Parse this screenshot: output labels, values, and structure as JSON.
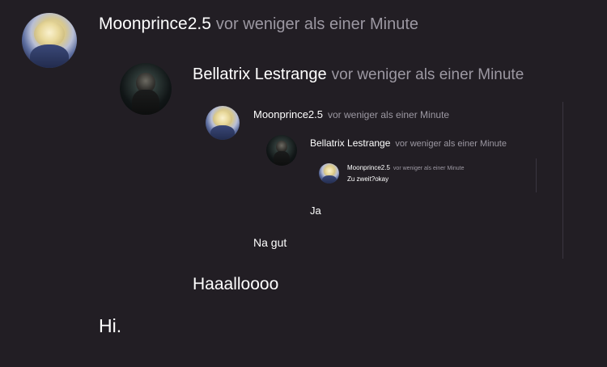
{
  "comments": {
    "level1": {
      "username": "Moonprince2.5",
      "timestamp": "vor weniger als einer Minute",
      "message": "Hi."
    },
    "level2": {
      "username": "Bellatrix Lestrange",
      "timestamp": "vor weniger als einer Minute",
      "message": "Haaalloooo"
    },
    "level3": {
      "username": "Moonprince2.5",
      "timestamp": "vor weniger als einer Minute",
      "message": "Na gut"
    },
    "level4": {
      "username": "Bellatrix Lestrange",
      "timestamp": "vor weniger als einer Minute",
      "message": "Ja"
    },
    "level5": {
      "username": "Moonprince2.5",
      "timestamp": "vor weniger als einer Minute",
      "message": "Zu zweit?okay"
    }
  },
  "colors": {
    "background": "#221e24",
    "text": "#ffffff",
    "timestamp": "#9c98a2"
  }
}
